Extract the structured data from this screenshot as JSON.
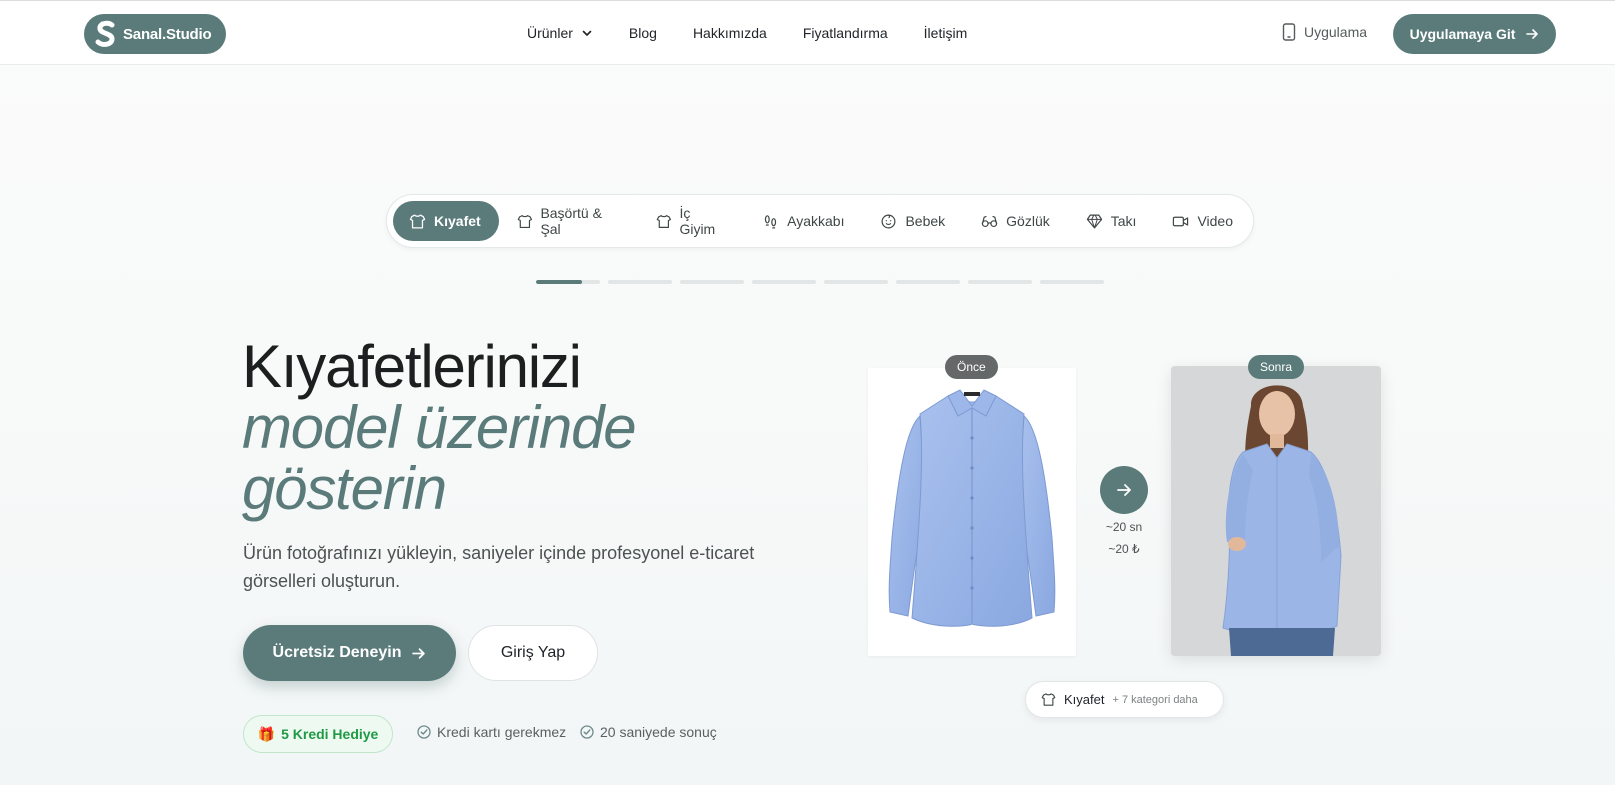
{
  "brand": {
    "name": "Sanal.Studio"
  },
  "nav": {
    "links": [
      {
        "label": "Ürünler",
        "has_dropdown": true
      },
      {
        "label": "Blog"
      },
      {
        "label": "Hakkımızda"
      },
      {
        "label": "Fiyatlandırma"
      },
      {
        "label": "İletişim"
      }
    ],
    "app_label": "Uygulama",
    "cta_label": "Uygulamaya Git"
  },
  "categories": {
    "active_index": 0,
    "items": [
      {
        "label": "Kıyafet",
        "icon": "shirt-icon"
      },
      {
        "label": "Başörtü & Şal",
        "icon": "shirt-icon"
      },
      {
        "label": "İç Giyim",
        "icon": "shirt-icon"
      },
      {
        "label": "Ayakkabı",
        "icon": "footprints-icon"
      },
      {
        "label": "Bebek",
        "icon": "baby-icon"
      },
      {
        "label": "Gözlük",
        "icon": "glasses-icon"
      },
      {
        "label": "Takı",
        "icon": "gem-icon"
      },
      {
        "label": "Video",
        "icon": "video-icon"
      }
    ],
    "slide_progress": [
      0.72,
      0,
      0,
      0,
      0,
      0,
      0,
      0
    ]
  },
  "hero": {
    "title_line1": "Kıyafetlerinizi",
    "title_line2": "model üzerinde",
    "title_line3": "gösterin",
    "subtitle": "Ürün fotoğrafınızı yükleyin, saniyeler içinde profesyonel e-ticaret görselleri oluşturun.",
    "primary_cta": "Ücretsiz Deneyin",
    "secondary_cta": "Giriş Yap",
    "credit_badge": "5 Kredi Hediye",
    "features": [
      "Kredi kartı gerekmez",
      "20 saniyede sonuç"
    ]
  },
  "comparison": {
    "before_label": "Önce",
    "after_label": "Sonra",
    "time": "~20 sn",
    "cost": "~20 ₺",
    "chip_category": "Kıyafet",
    "chip_more": "+ 7 kategori daha"
  },
  "colors": {
    "accent": "#5b7b7b",
    "credit_green": "#1e9a45",
    "shirt_blue": "#98b4e6"
  }
}
